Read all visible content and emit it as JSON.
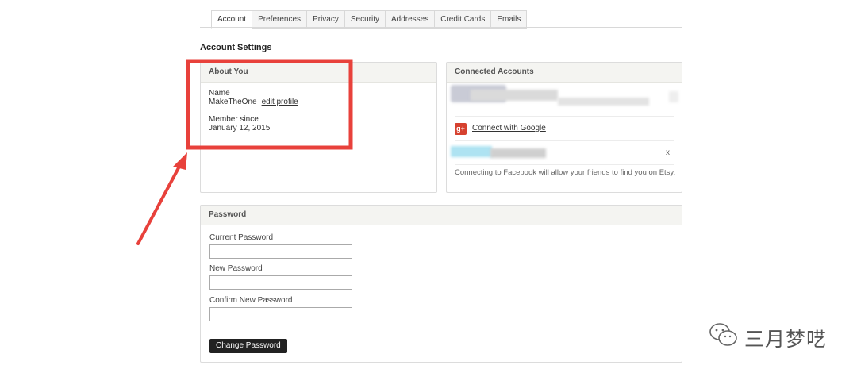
{
  "tabs": [
    {
      "label": "Account",
      "active": true
    },
    {
      "label": "Preferences"
    },
    {
      "label": "Privacy"
    },
    {
      "label": "Security"
    },
    {
      "label": "Addresses"
    },
    {
      "label": "Credit Cards"
    },
    {
      "label": "Emails"
    }
  ],
  "page_title": "Account Settings",
  "about": {
    "heading": "About You",
    "name_label": "Name",
    "name_value": "MakeTheOne",
    "edit_link": "edit profile",
    "member_label": "Member since",
    "member_value": "January 12, 2015"
  },
  "connected": {
    "heading": "Connected Accounts",
    "google_link": "Connect with Google",
    "google_icon_glyph": "g+",
    "close_glyph": "x",
    "facebook_note": "Connecting to Facebook will allow your friends to find you on Etsy."
  },
  "password": {
    "heading": "Password",
    "current_label": "Current Password",
    "new_label": "New Password",
    "confirm_label": "Confirm New Password",
    "button_label": "Change Password"
  },
  "annotation": {
    "color": "#e8413b"
  },
  "watermark": {
    "text": "三月梦呓"
  }
}
